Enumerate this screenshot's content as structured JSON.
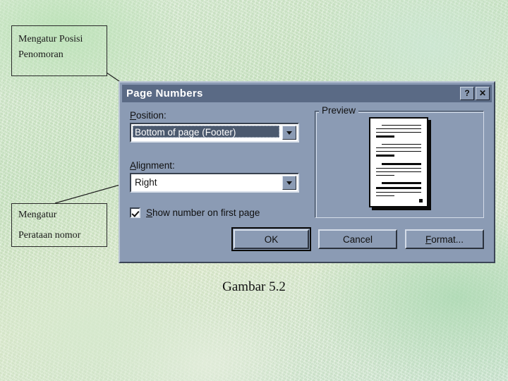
{
  "slide": {
    "caption": "Gambar 5.2",
    "background_color": "#d6ead0"
  },
  "annotations": [
    {
      "id": "position-callout",
      "line1": "Mengatur Posisi",
      "line2": "Penomoran"
    },
    {
      "id": "alignment-callout",
      "line1": "Mengatur",
      "line2": "Perataan nomor"
    }
  ],
  "dialog": {
    "title": "Page Numbers",
    "titlebar_color": "#5a6a85",
    "face_color": "#8b9bb4",
    "caption_buttons": [
      {
        "name": "help-button",
        "glyph": "?"
      },
      {
        "name": "close-button",
        "glyph": "✕"
      }
    ],
    "position": {
      "label": "Position:",
      "accelerator": "P",
      "value": "Bottom of page (Footer)",
      "selected": true
    },
    "alignment": {
      "label": "Alignment:",
      "accelerator": "A",
      "value": "Right",
      "selected": false
    },
    "checkbox": {
      "label": "Show number on first page",
      "accelerator": "S",
      "checked": true
    },
    "preview": {
      "legend": "Preview",
      "page_number_position": "bottom-right"
    },
    "buttons": [
      {
        "name": "ok-button",
        "label": "OK",
        "default": true
      },
      {
        "name": "cancel-button",
        "label": "Cancel",
        "default": false
      },
      {
        "name": "format-button",
        "label": "Format...",
        "default": false,
        "accelerator": "F"
      }
    ]
  }
}
